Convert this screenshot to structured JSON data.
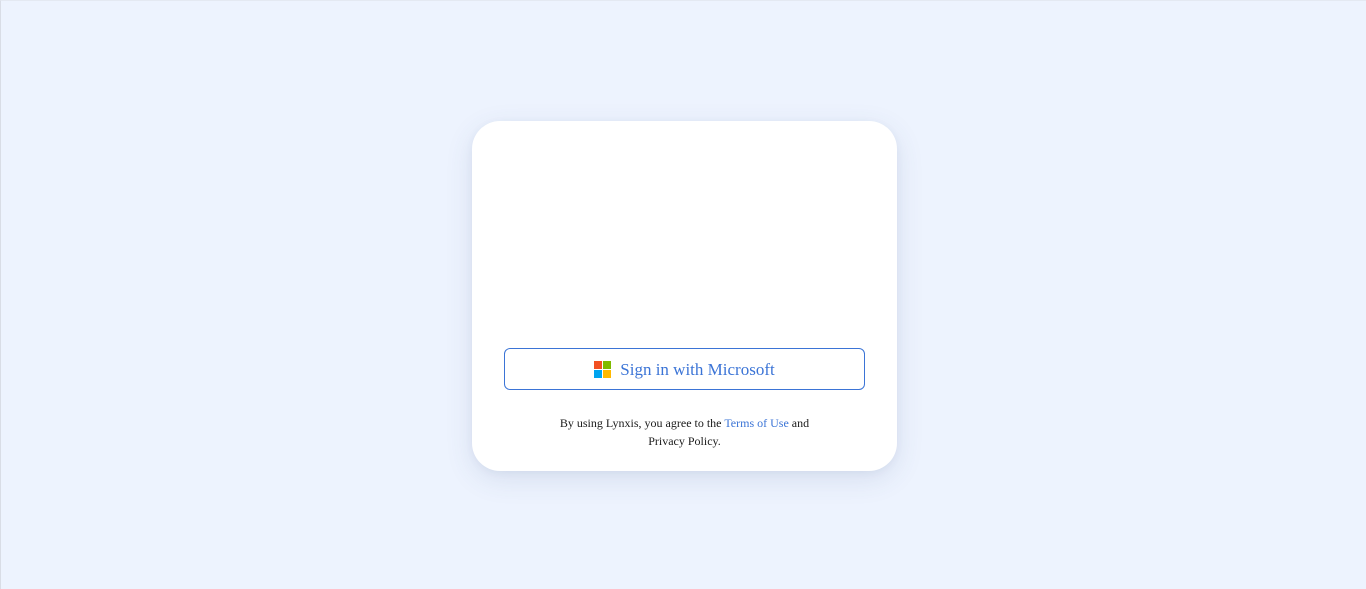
{
  "login": {
    "signin_button_label": "Sign in with Microsoft",
    "terms_prefix": "By using Lynxis, you agree to the",
    "terms_link": "Terms of Use",
    "terms_and": "and",
    "privacy_text": "Privacy Policy."
  },
  "colors": {
    "background": "#edf3fe",
    "card": "#ffffff",
    "accent": "#3b74d6",
    "text": "#1a1a1a"
  },
  "icons": {
    "signin_icon": "microsoft-logo-icon"
  }
}
